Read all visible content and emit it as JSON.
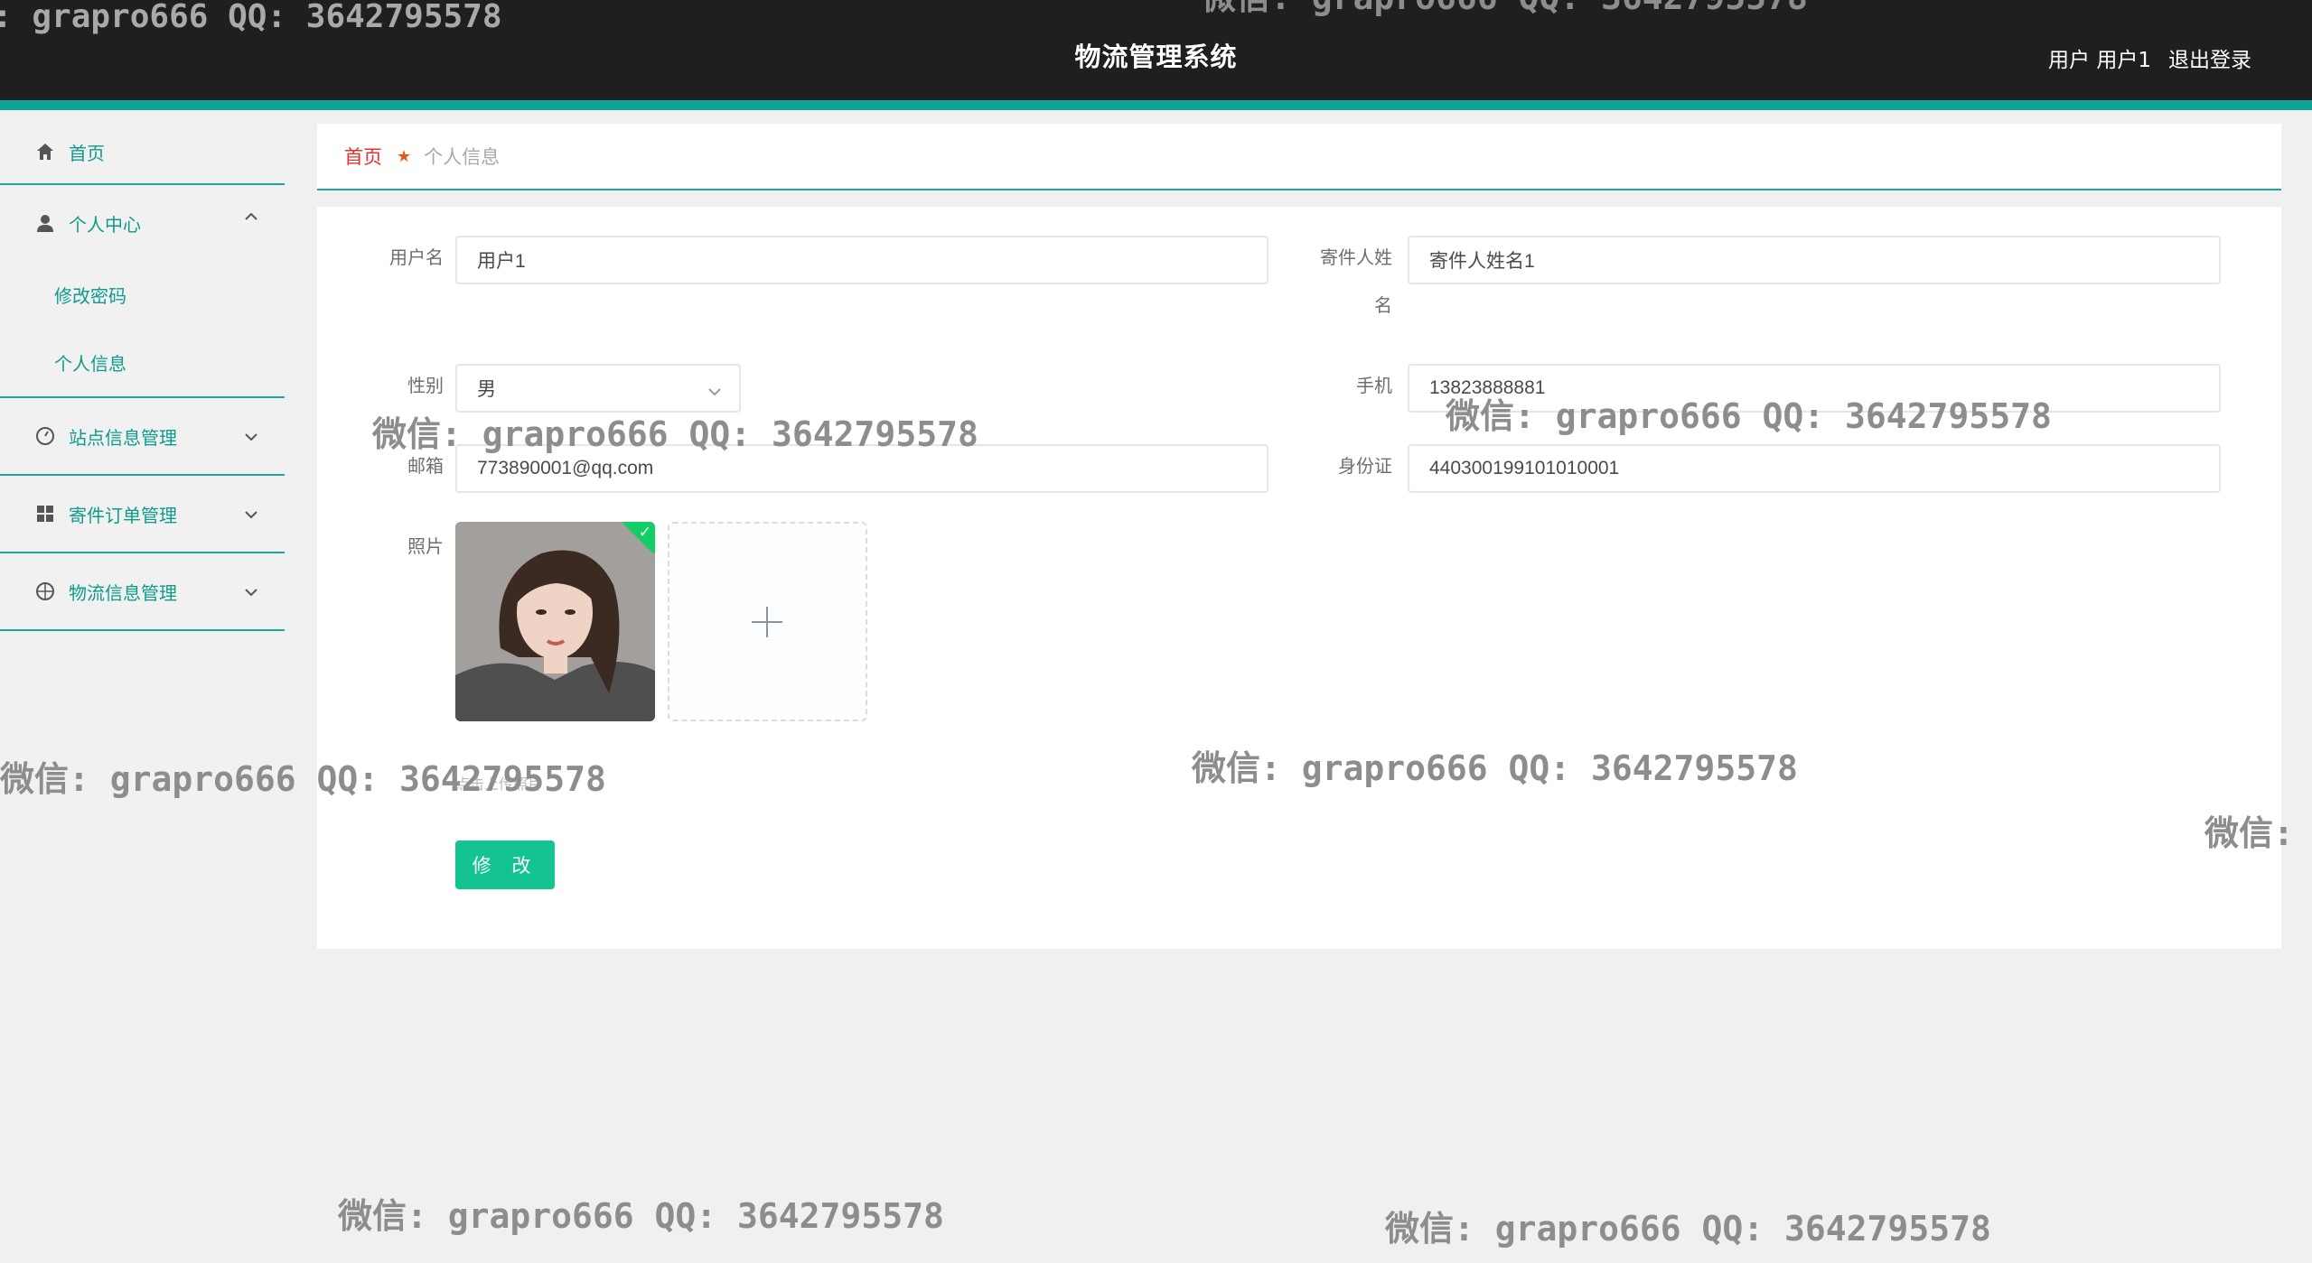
{
  "header": {
    "title": "物流管理系统",
    "user_text": "用户 用户1",
    "logout": "退出登录"
  },
  "sidebar": {
    "home": "首页",
    "personal_center": "个人中心",
    "change_password": "修改密码",
    "personal_info": "个人信息",
    "station_mgmt": "站点信息管理",
    "order_mgmt": "寄件订单管理",
    "logistics_mgmt": "物流信息管理"
  },
  "breadcrumb": {
    "home": "首页",
    "current": "个人信息"
  },
  "form": {
    "username_label": "用户名",
    "username_value": "用户1",
    "sender_name_label_1": "寄件人姓",
    "sender_name_label_2": "名",
    "sender_name_value": "寄件人姓名1",
    "gender_label": "性别",
    "gender_value": "男",
    "phone_label": "手机",
    "phone_value": "13823888881",
    "email_label": "邮箱",
    "email_value": "773890001@qq.com",
    "id_label": "身份证",
    "id_value": "440300199101010001",
    "photo_label": "照片",
    "upload_tip": "点击上传照片",
    "submit": "修 改"
  },
  "watermarks": {
    "top_left": ": grapro666 QQ: 3642795578",
    "top_center": "微信: grapro666 QQ: 3642795578",
    "w1": "微信: grapro666 QQ: 3642795578",
    "w2": "微信: grapro666 QQ: 3642795578",
    "w3": "微信: grapro666 QQ: 3642795578",
    "w4": "微信: grapro666 QQ: 3642795578",
    "w5": "微信:",
    "w6": "微信: grapro666 QQ: 3642795578",
    "w7": "微信: grapro666 QQ: 3642795578"
  },
  "colors": {
    "header_bg": "#1f1f1f",
    "accent": "#0fa497",
    "menu_text": "#0e9b8c",
    "button": "#13c491",
    "breadcrumb_home": "#e0322f"
  },
  "icons": [
    "home-icon",
    "user-icon",
    "chevron-up-icon",
    "chevron-down-icon",
    "dashboard-icon",
    "grid-icon",
    "target-icon",
    "star-icon",
    "check-icon",
    "plus-icon"
  ]
}
